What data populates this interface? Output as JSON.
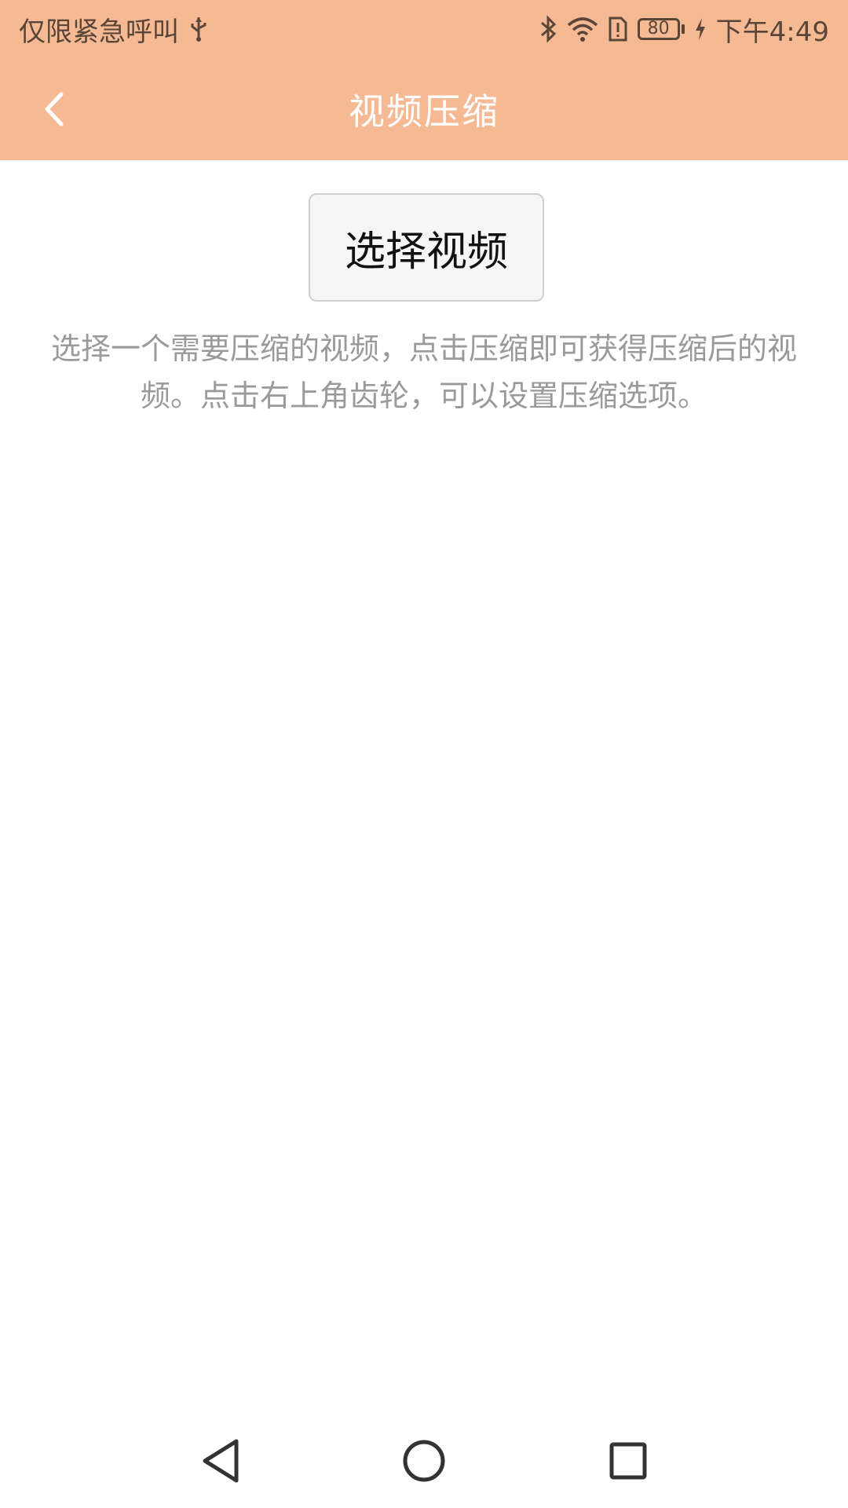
{
  "status_bar": {
    "carrier_text": "仅限紧急呼叫",
    "battery_level": "80",
    "time": "下午4:49"
  },
  "toolbar": {
    "title": "视频压缩"
  },
  "main": {
    "select_button_label": "选择视频",
    "description": "选择一个需要压缩的视频，点击压缩即可获得压缩后的视频。点击右上角齿轮，可以设置压缩选项。"
  },
  "colors": {
    "accent": "#f5b994",
    "title_text": "#ffffff",
    "hint_text": "#9a9a9a"
  },
  "icons": {
    "usb": "usb-icon",
    "bluetooth": "bluetooth-icon",
    "wifi": "wifi-icon",
    "sim_alert": "sim-alert-icon",
    "battery": "battery-icon",
    "charging": "charging-icon",
    "back": "back-arrow-icon",
    "nav_back": "nav-back-icon",
    "nav_home": "nav-home-icon",
    "nav_recents": "nav-recents-icon"
  }
}
